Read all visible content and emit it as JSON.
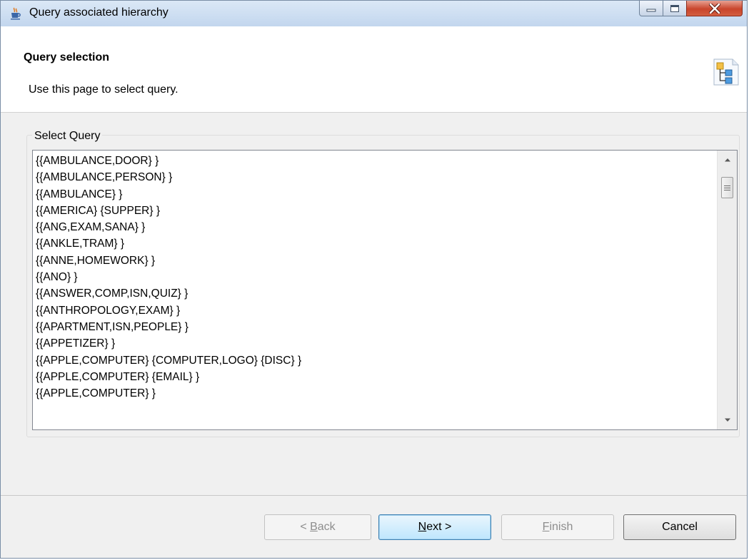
{
  "window": {
    "title": "Query associated hierarchy",
    "app_icon": "java-cup-icon",
    "controls": {
      "minimize": "minimize-icon",
      "maximize": "maximize-icon",
      "close": "close-icon"
    }
  },
  "header": {
    "title": "Query selection",
    "description": "Use this page to select query.",
    "icon": "hierarchy-icon"
  },
  "select_query": {
    "label": "Select Query",
    "items": [
      "{{AMBULANCE,DOOR} }",
      "{{AMBULANCE,PERSON} }",
      "{{AMBULANCE} }",
      "{{AMERICA} {SUPPER} }",
      "{{ANG,EXAM,SANA} }",
      "{{ANKLE,TRAM} }",
      "{{ANNE,HOMEWORK} }",
      "{{ANO} }",
      "{{ANSWER,COMP,ISN,QUIZ} }",
      "{{ANTHROPOLOGY,EXAM} }",
      "{{APARTMENT,ISN,PEOPLE} }",
      "{{APPETIZER} }",
      "{{APPLE,COMPUTER} {COMPUTER,LOGO} {DISC} }",
      "{{APPLE,COMPUTER} {EMAIL} }",
      "{{APPLE,COMPUTER} }"
    ]
  },
  "footer": {
    "back": {
      "mnemonic": "B",
      "prefix": "< ",
      "rest": "ack"
    },
    "next": {
      "mnemonic": "N",
      "rest": "ext >"
    },
    "finish": {
      "mnemonic": "F",
      "rest": "inish"
    },
    "cancel": {
      "label": "Cancel"
    }
  },
  "colors": {
    "title_bar": "#c9daee",
    "close_button": "#c9452c",
    "default_button_border": "#3c7fb1",
    "disabled_text": "#8d8d8d"
  }
}
